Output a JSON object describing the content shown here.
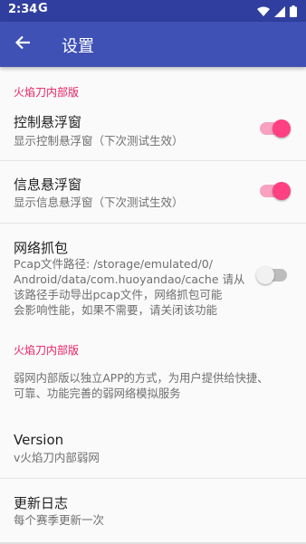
{
  "status": {
    "time": "2:34",
    "g_label": "G"
  },
  "appbar": {
    "title": "设置"
  },
  "sections": {
    "cat1": "火焰刀内部版",
    "float_ctrl": {
      "title": "控制悬浮窗",
      "summary": "显示控制悬浮窗（下次测试生效）",
      "enabled": true
    },
    "float_info": {
      "title": "信息悬浮窗",
      "summary": "显示信息悬浮窗（下次测试生效）",
      "enabled": true
    },
    "capture": {
      "title": "网络抓包",
      "summary_lines": [
        "Pcap文件路径: /storage/emulated/0/",
        "Android/data/com.huoyandao/cache 请从",
        "该路径手动导出pcap文件，网络抓包可能",
        "会影响性能，如果不需要，请关闭该功能"
      ],
      "enabled": false
    },
    "cat2": "火焰刀内部版",
    "about_lines": [
      "弱网内部版以独立APP的方式，为用户提供给快捷、",
      "可靠、功能完善的弱网络模拟服务"
    ],
    "version": {
      "title": "Version",
      "summary": "v火焰刀内部弱网"
    },
    "changelog": {
      "title": "更新日志",
      "summary": "每个赛季更新一次"
    }
  },
  "colors": {
    "primary": "#3f51b5",
    "primary_dark": "#303f9f",
    "accent": "#ff4081",
    "category": "#e91e63"
  }
}
